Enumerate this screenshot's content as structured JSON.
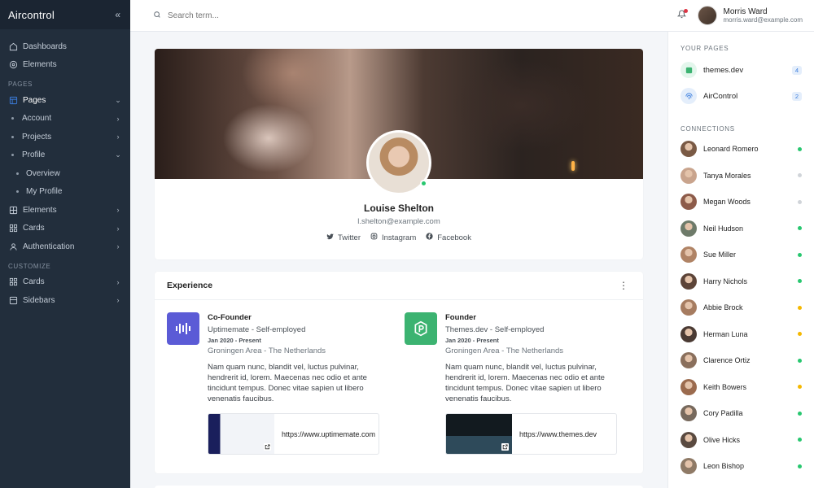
{
  "brand": {
    "name": "Aircontrol",
    "collapse_icon": "«"
  },
  "sidebar": {
    "items": [
      {
        "label": "Dashboards",
        "icon": "home-icon"
      },
      {
        "label": "Elements",
        "icon": "gear-icon"
      }
    ],
    "section_pages": "PAGES",
    "pages": {
      "label": "Pages",
      "icon": "layout-icon"
    },
    "pages_children": [
      {
        "label": "Account"
      },
      {
        "label": "Projects"
      },
      {
        "label": "Profile"
      }
    ],
    "profile_children": [
      {
        "label": "Overview"
      },
      {
        "label": "My Profile"
      }
    ],
    "more": [
      {
        "label": "Elements",
        "icon": "grid-icon"
      },
      {
        "label": "Cards",
        "icon": "cards-icon"
      },
      {
        "label": "Authentication",
        "icon": "user-icon"
      }
    ],
    "section_customize": "CUSTOMIZE",
    "customize": [
      {
        "label": "Cards",
        "icon": "cards-icon"
      },
      {
        "label": "Sidebars",
        "icon": "sidebar-icon"
      }
    ]
  },
  "search": {
    "placeholder": "Search term..."
  },
  "user": {
    "name": "Morris Ward",
    "email": "morris.ward@example.com"
  },
  "profile": {
    "name": "Louise Shelton",
    "email": "l.shelton@example.com",
    "socials": [
      {
        "label": "Twitter",
        "icon": "twitter-icon"
      },
      {
        "label": "Instagram",
        "icon": "instagram-icon"
      },
      {
        "label": "Facebook",
        "icon": "facebook-icon"
      }
    ]
  },
  "experience": {
    "title": "Experience",
    "jobs": [
      {
        "role": "Co-Founder",
        "company": "Uptimemate - Self-employed",
        "date": "Jan 2020 - Present",
        "location": "Groningen Area - The Netherlands",
        "description": "Nam quam nunc, blandit vel, luctus pulvinar, hendrerit id, lorem. Maecenas nec odio et ante tincidunt tempus. Donec vitae sapien ut libero venenatis faucibus.",
        "url": "https://www.uptimemate.com",
        "logo_color": "#5b5bd6"
      },
      {
        "role": "Founder",
        "company": "Themes.dev - Self-employed",
        "date": "Jan 2020 - Present",
        "location": "Groningen Area - The Netherlands",
        "description": "Nam quam nunc, blandit vel, luctus pulvinar, hendrerit id, lorem. Maecenas nec odio et ante tincidunt tempus. Donec vitae sapien ut libero venenatis faucibus.",
        "url": "https://www.themes.dev",
        "logo_color": "#3cb371"
      }
    ]
  },
  "right_panel": {
    "your_pages_title": "YOUR PAGES",
    "pages": [
      {
        "name": "themes.dev",
        "count": "4"
      },
      {
        "name": "AirControl",
        "count": "2"
      }
    ],
    "connections_title": "CONNECTIONS",
    "connections": [
      {
        "name": "Leonard Romero",
        "status": "online"
      },
      {
        "name": "Tanya Morales",
        "status": "offline"
      },
      {
        "name": "Megan Woods",
        "status": "offline"
      },
      {
        "name": "Neil Hudson",
        "status": "online"
      },
      {
        "name": "Sue Miller",
        "status": "online"
      },
      {
        "name": "Harry Nichols",
        "status": "online"
      },
      {
        "name": "Abbie Brock",
        "status": "away"
      },
      {
        "name": "Herman Luna",
        "status": "away"
      },
      {
        "name": "Clarence Ortiz",
        "status": "online"
      },
      {
        "name": "Keith Bowers",
        "status": "away"
      },
      {
        "name": "Cory Padilla",
        "status": "online"
      },
      {
        "name": "Olive Hicks",
        "status": "online"
      },
      {
        "name": "Leon Bishop",
        "status": "online"
      }
    ]
  },
  "colors": {
    "online": "#28c76f",
    "offline": "#d0d4d9",
    "away": "#f5b800",
    "accent": "#3b7ddd",
    "sidebar": "#222e3c"
  }
}
